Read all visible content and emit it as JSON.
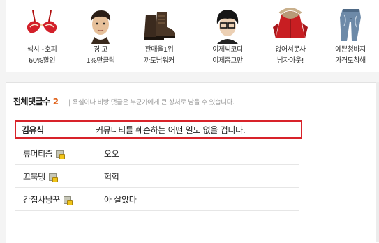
{
  "products": [
    {
      "line1": "섹시~호피",
      "line2": "60%할인",
      "icon": "red-bra-icon"
    },
    {
      "line1": "경 고",
      "line2": "1%만클릭",
      "icon": "young-man-photo-icon"
    },
    {
      "line1": "판매율1위",
      "line2": "까도남워커",
      "icon": "walker-boots-icon"
    },
    {
      "line1": "이제씨코디",
      "line2": "이제좀그만",
      "icon": "glasses-man-photo-icon"
    },
    {
      "line1": "없어서못사",
      "line2": "남자아웃!",
      "icon": "red-parka-icon"
    },
    {
      "line1": "예쁜청바지",
      "line2": "가격도착해",
      "icon": "jeans-icon"
    }
  ],
  "comments_section": {
    "title": "전체댓글수",
    "count": "2",
    "notice": "| 욕설이나 비방 댓글은 누군가에게 큰 상처로 남을 수 있습니다."
  },
  "comments": [
    {
      "author": "김유식",
      "text": "커뮤니티를 훼손하는 어떤 일도 없을 겁니다.",
      "highlighted": true,
      "badge": false
    },
    {
      "author": "류머티즘",
      "text": "오오",
      "highlighted": false,
      "badge": true
    },
    {
      "author": "끄북탱",
      "text": "헉헉",
      "highlighted": false,
      "badge": true
    },
    {
      "author": "간첩사냥꾼",
      "text": "아 살았다",
      "highlighted": false,
      "badge": true
    }
  ],
  "colors": {
    "highlight_border": "#d8232a",
    "count": "#e0641e",
    "notice": "#9a9a9a"
  }
}
